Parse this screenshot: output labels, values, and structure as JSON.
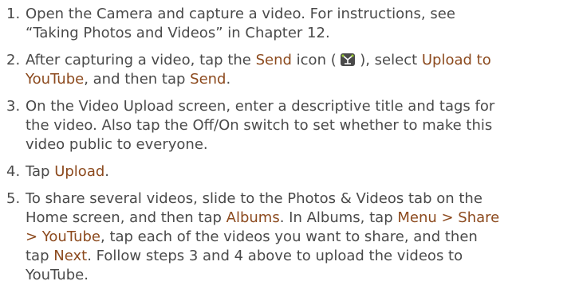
{
  "steps": [
    {
      "number": "1.",
      "lines": [
        "Open the Camera and capture a video. For instructions, see",
        "“Taking Photos and Videos” in Chapter 12."
      ]
    },
    {
      "number": "2.",
      "line1_a": "After capturing a video, tap the ",
      "line1_send": "Send",
      "line1_b": " icon (",
      "line1_c": "), select ",
      "line1_upload": "Upload to",
      "line2_youtube": "YouTube",
      "line2_a": ", and then tap ",
      "line2_send": "Send",
      "line2_b": "."
    },
    {
      "number": "3.",
      "lines": [
        "On the Video Upload screen, enter a descriptive title and tags for",
        "the video. Also tap the Off/On switch to set whether to make this",
        "video public to everyone."
      ]
    },
    {
      "number": "4.",
      "a": "Tap ",
      "upload": "Upload",
      "b": "."
    },
    {
      "number": "5.",
      "l1": "To share several videos, slide to the Photos & Videos tab on the",
      "l2_a": "Home screen, and then tap ",
      "l2_albums": "Albums",
      "l2_b": ". In Albums, tap ",
      "l2_menu": "Menu > Share",
      "l3_youtube": "> YouTube",
      "l3_b": ", tap each of the videos you want to share, and then",
      "l4_a": "tap ",
      "l4_next": "Next",
      "l4_b": ". Follow steps 3 and 4 above to upload the videos to",
      "l5": "YouTube."
    }
  ],
  "colors": {
    "text": "#4a4a4a",
    "highlight": "#8c4a1e"
  },
  "icons": {
    "send": "send-icon"
  }
}
